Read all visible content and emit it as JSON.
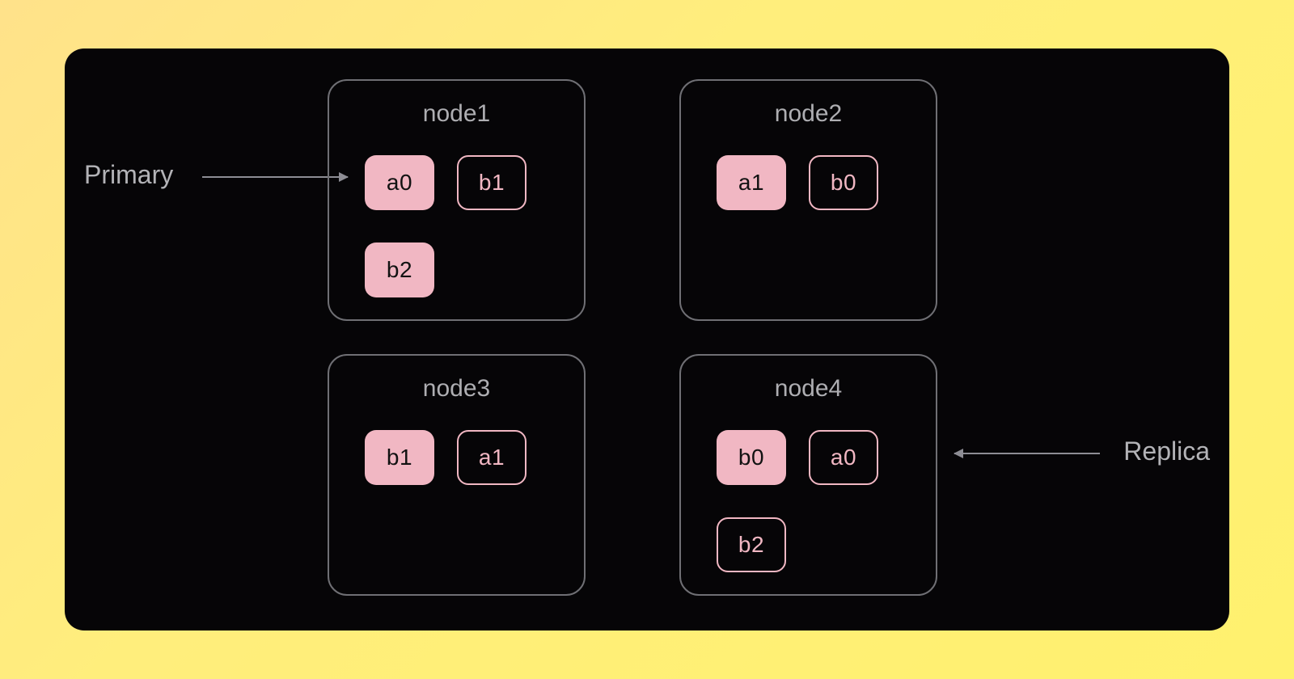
{
  "labels": {
    "primary": "Primary",
    "replica": "Replica"
  },
  "colors": {
    "primary_fill": "#f1b7c3",
    "replica_border": "#f1b7c3",
    "node_border": "#6f6f74",
    "panel_bg": "#060507"
  },
  "nodes": [
    {
      "id": "node1",
      "title": "node1",
      "shards": [
        {
          "label": "a0",
          "kind": "primary"
        },
        {
          "label": "b1",
          "kind": "replica"
        },
        {
          "label": "b2",
          "kind": "primary"
        }
      ]
    },
    {
      "id": "node2",
      "title": "node2",
      "shards": [
        {
          "label": "a1",
          "kind": "primary"
        },
        {
          "label": "b0",
          "kind": "replica"
        }
      ]
    },
    {
      "id": "node3",
      "title": "node3",
      "shards": [
        {
          "label": "b1",
          "kind": "primary"
        },
        {
          "label": "a1",
          "kind": "replica"
        }
      ]
    },
    {
      "id": "node4",
      "title": "node4",
      "shards": [
        {
          "label": "b0",
          "kind": "primary"
        },
        {
          "label": "a0",
          "kind": "replica"
        },
        {
          "label": "b2",
          "kind": "replica"
        }
      ]
    }
  ]
}
